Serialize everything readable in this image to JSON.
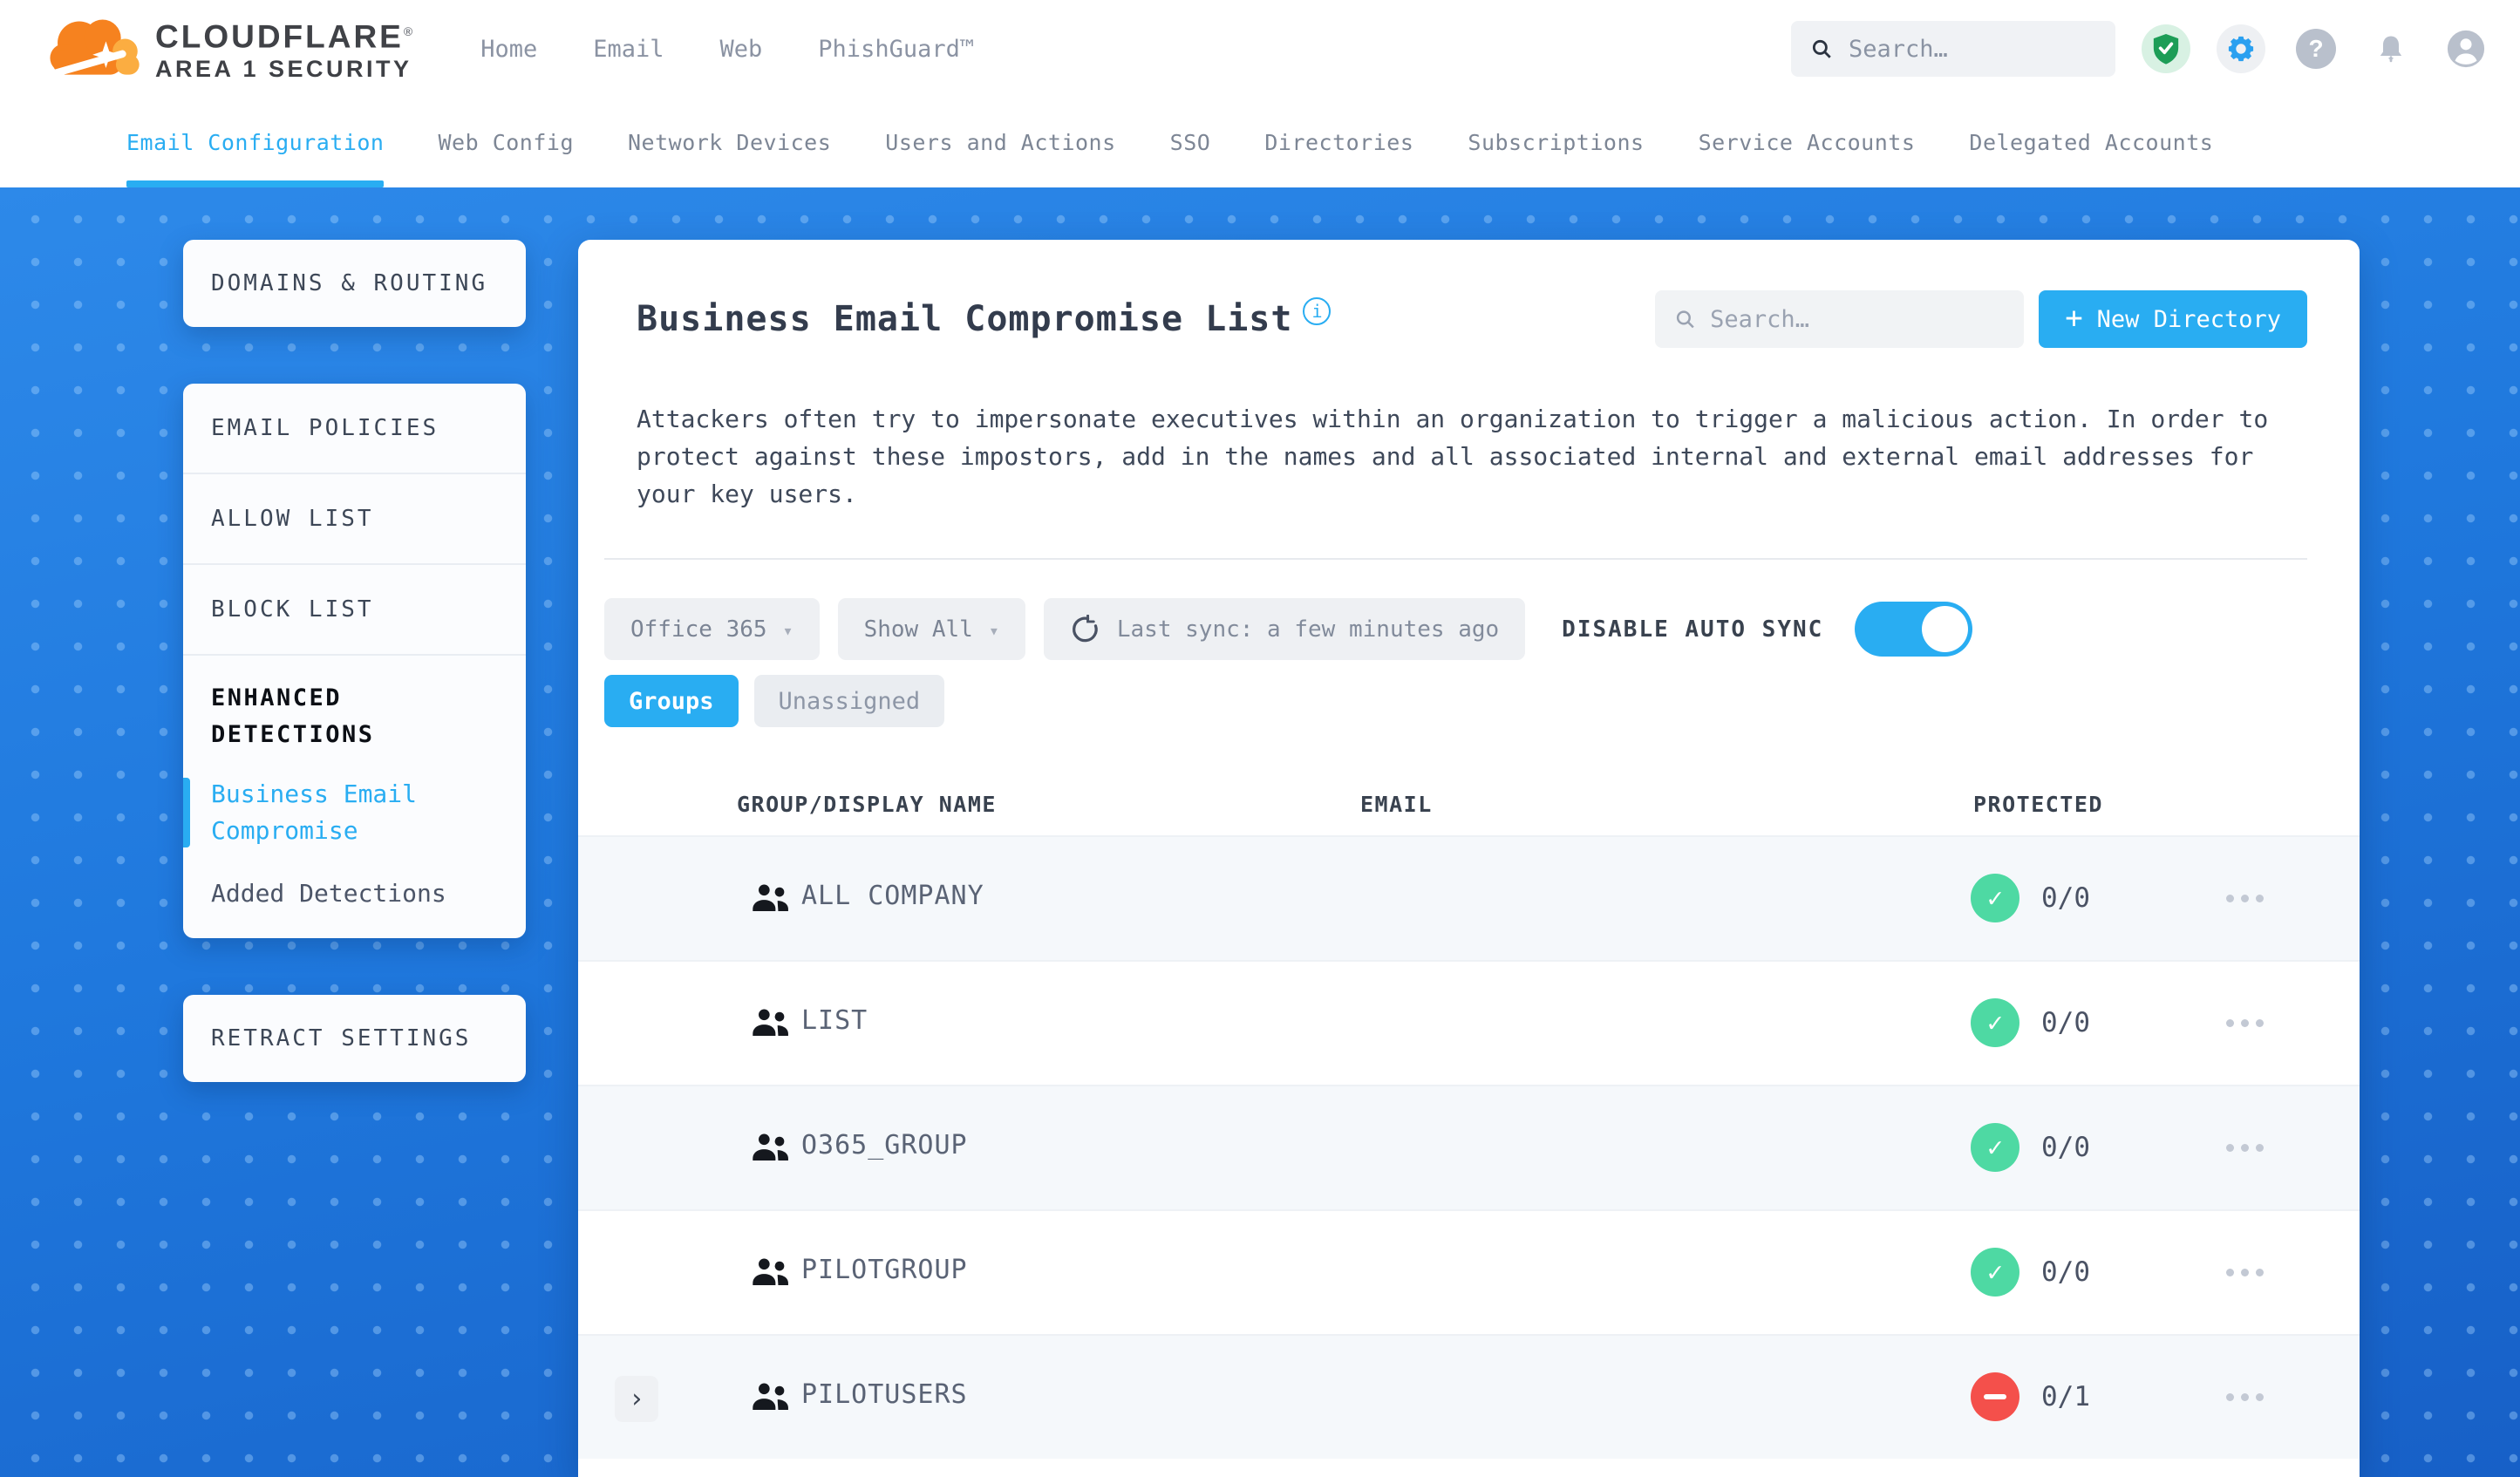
{
  "brand": {
    "title": "CLOUDFLARE",
    "reg_mark": "®",
    "subtitle": "AREA 1 SECURITY"
  },
  "top_nav": {
    "items": [
      {
        "label": "Home"
      },
      {
        "label": "Email"
      },
      {
        "label": "Web"
      },
      {
        "label": "PhishGuard™"
      }
    ]
  },
  "header": {
    "search_placeholder": "Search…"
  },
  "tab_bar": {
    "items": [
      {
        "label": "Email Configuration",
        "active": true
      },
      {
        "label": "Web Config",
        "active": false
      },
      {
        "label": "Network Devices",
        "active": false
      },
      {
        "label": "Users and Actions",
        "active": false
      },
      {
        "label": "SSO",
        "active": false
      },
      {
        "label": "Directories",
        "active": false
      },
      {
        "label": "Subscriptions",
        "active": false
      },
      {
        "label": "Service Accounts",
        "active": false
      },
      {
        "label": "Delegated Accounts",
        "active": false
      }
    ]
  },
  "sidebar": {
    "domains_routing": "DOMAINS & ROUTING",
    "email_policies": "EMAIL POLICIES",
    "allow_list": "ALLOW LIST",
    "block_list": "BLOCK LIST",
    "enhanced_detections": "ENHANCED DETECTIONS",
    "business_email_compromise": "Business Email Compromise",
    "added_detections": "Added Detections",
    "retract_settings": "RETRACT SETTINGS"
  },
  "main": {
    "title": "Business Email Compromise List",
    "search_placeholder": "Search…",
    "new_directory_label": "New Directory",
    "description": "Attackers often try to impersonate executives within an organization to trigger a malicious action. In order to protect against these impostors, add in the names and all associated internal and external email addresses for your key users.",
    "filters": {
      "connector": "Office 365",
      "show_filter": "Show All",
      "last_sync": "Last sync: a few minutes ago",
      "auto_sync_label": "DISABLE AUTO SYNC",
      "auto_sync_enabled": true
    },
    "view_tabs": {
      "groups": "Groups",
      "unassigned": "Unassigned"
    },
    "table": {
      "columns": [
        "GROUP/DISPLAY NAME",
        "EMAIL",
        "PROTECTED"
      ],
      "rows": [
        {
          "name": "ALL COMPANY",
          "email": "",
          "protected": "0/0",
          "status": "ok",
          "expandable": false
        },
        {
          "name": "LIST",
          "email": "",
          "protected": "0/0",
          "status": "ok",
          "expandable": false
        },
        {
          "name": "O365_GROUP",
          "email": "",
          "protected": "0/0",
          "status": "ok",
          "expandable": false
        },
        {
          "name": "PILOTGROUP",
          "email": "",
          "protected": "0/0",
          "status": "ok",
          "expandable": false
        },
        {
          "name": "PILOTUSERS",
          "email": "",
          "protected": "0/1",
          "status": "blocked",
          "expandable": true
        }
      ]
    }
  },
  "glyphs": {
    "plus": "+",
    "caret_down": "▾",
    "chevron_right": "›",
    "check": "✓",
    "question": "?",
    "info": "i"
  },
  "icons": {
    "header": [
      "search-icon",
      "shield-check-icon",
      "gear-icon",
      "help-icon",
      "bell-icon",
      "account-icon"
    ],
    "main": [
      "info-icon",
      "search-icon",
      "plus-icon",
      "refresh-icon",
      "group-icon",
      "check-icon",
      "minus-icon",
      "ellipsis-icon",
      "chevron-right-icon",
      "caret-down-icon"
    ]
  },
  "colors": {
    "accent_cyan": "#29adf2",
    "background_blue": "#1f78dd",
    "success_green": "#4ed9a3",
    "error_red": "#f4504b",
    "navy_text": "#39424f"
  }
}
